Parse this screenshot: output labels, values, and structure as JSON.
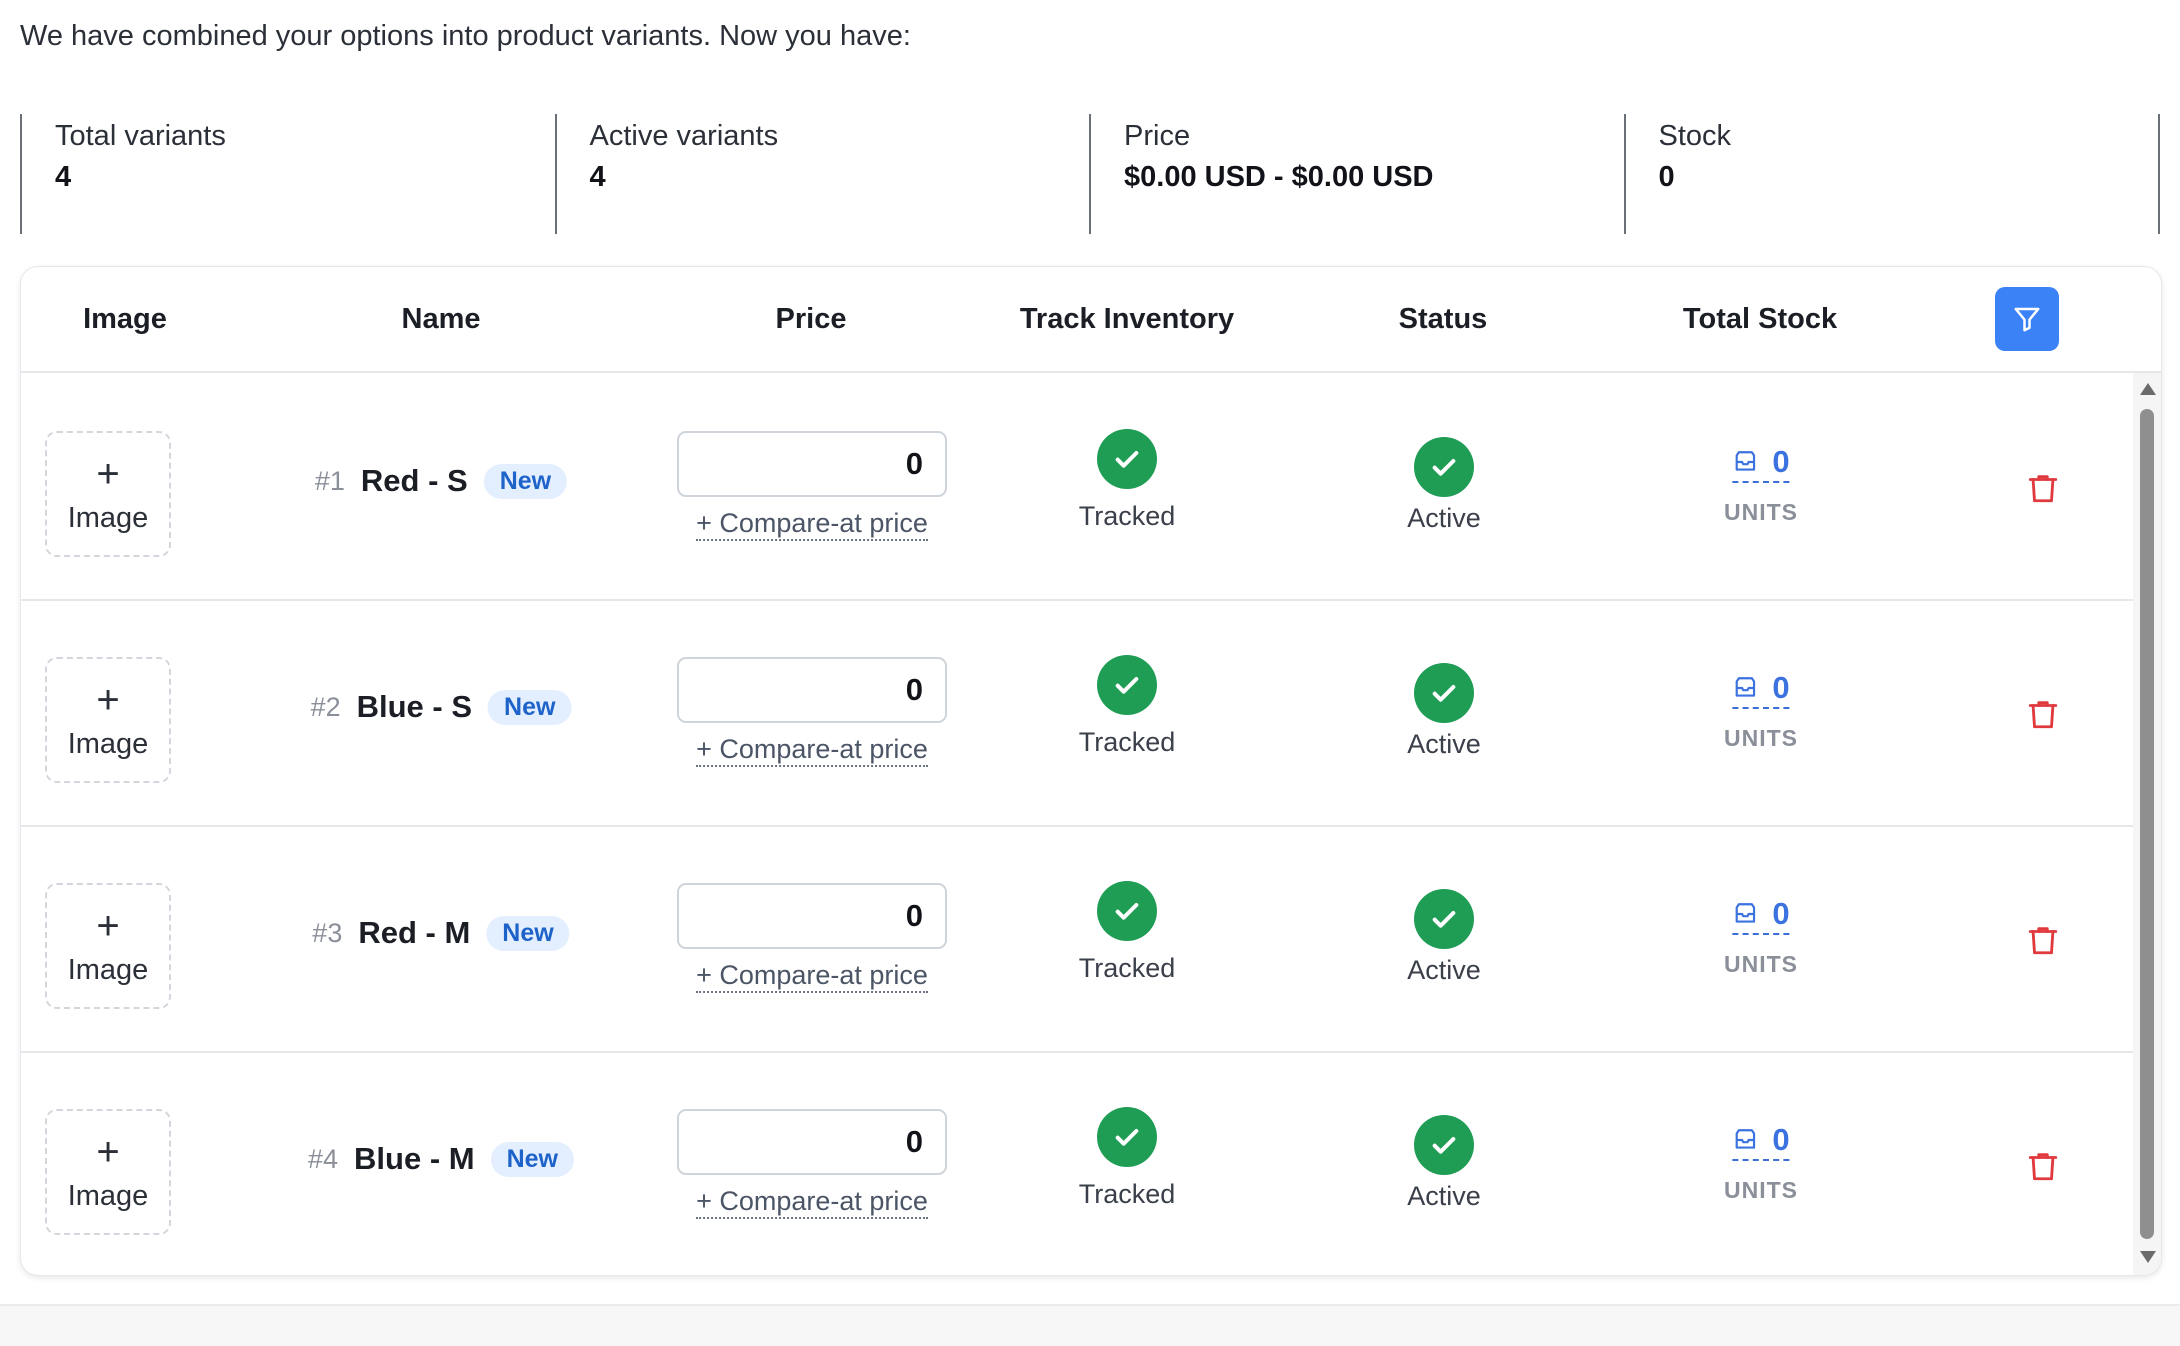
{
  "intro_text": "We have combined your options into product variants. Now you have:",
  "summary": [
    {
      "label": "Total variants",
      "value": "4"
    },
    {
      "label": "Active variants",
      "value": "4"
    },
    {
      "label": "Price",
      "value": "$0.00 USD - $0.00 USD"
    },
    {
      "label": "Stock",
      "value": "0"
    }
  ],
  "table": {
    "headers": {
      "image": "Image",
      "name": "Name",
      "price": "Price",
      "track_inventory": "Track Inventory",
      "status": "Status",
      "total_stock": "Total Stock"
    },
    "filter_icon": "filter-icon",
    "rows": [
      {
        "image_plus": "+",
        "image_label": "Image",
        "number": "#1",
        "name": "Red - S",
        "badge": "New",
        "price": "0",
        "compare_link": "+ Compare-at price",
        "track_label": "Tracked",
        "status_label": "Active",
        "stock": "0",
        "units": "UNITS"
      },
      {
        "image_plus": "+",
        "image_label": "Image",
        "number": "#2",
        "name": "Blue - S",
        "badge": "New",
        "price": "0",
        "compare_link": "+ Compare-at price",
        "track_label": "Tracked",
        "status_label": "Active",
        "stock": "0",
        "units": "UNITS"
      },
      {
        "image_plus": "+",
        "image_label": "Image",
        "number": "#3",
        "name": "Red - M",
        "badge": "New",
        "price": "0",
        "compare_link": "+ Compare-at price",
        "track_label": "Tracked",
        "status_label": "Active",
        "stock": "0",
        "units": "UNITS"
      },
      {
        "image_plus": "+",
        "image_label": "Image",
        "number": "#4",
        "name": "Blue - M",
        "badge": "New",
        "price": "0",
        "compare_link": "+ Compare-at price",
        "track_label": "Tracked",
        "status_label": "Active",
        "stock": "0",
        "units": "UNITS"
      }
    ]
  },
  "colors": {
    "accent": "#3b82f6",
    "success": "#1f9d55",
    "danger": "#e0393e",
    "badge_bg": "#e3efff",
    "badge_text": "#1d63c9"
  }
}
